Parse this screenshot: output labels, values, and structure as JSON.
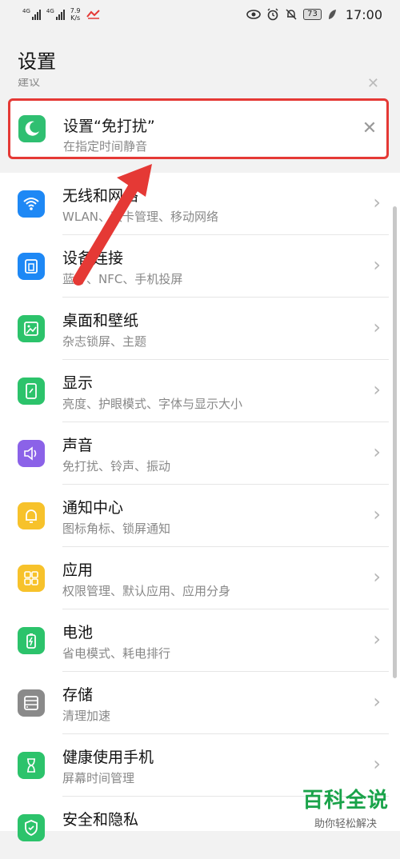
{
  "status_bar": {
    "signal1": "4G",
    "signal2": "4G",
    "speed_value": "7.9",
    "speed_unit": "K/s",
    "battery": "73",
    "time": "17:00"
  },
  "page": {
    "title": "设置",
    "faded_header": "建议"
  },
  "suggestion": {
    "title": "设置“免打扰”",
    "subtitle": "在指定时间静音",
    "icon": "moon-icon",
    "color": "#2fbf71"
  },
  "settings": [
    {
      "title": "无线和网络",
      "subtitle": "WLAN、双卡管理、移动网络",
      "icon": "wifi-icon",
      "color": "#1e88f5"
    },
    {
      "title": "设备连接",
      "subtitle": "蓝牙、NFC、手机投屏",
      "icon": "device-connect-icon",
      "color": "#1e88f5"
    },
    {
      "title": "桌面和壁纸",
      "subtitle": "杂志锁屏、主题",
      "icon": "wallpaper-icon",
      "color": "#2cc36b"
    },
    {
      "title": "显示",
      "subtitle": "亮度、护眼模式、字体与显示大小",
      "icon": "display-icon",
      "color": "#2cc36b"
    },
    {
      "title": "声音",
      "subtitle": "免打扰、铃声、振动",
      "icon": "speaker-icon",
      "color": "#8b62e8"
    },
    {
      "title": "通知中心",
      "subtitle": "图标角标、锁屏通知",
      "icon": "bell-icon",
      "color": "#f7c22b"
    },
    {
      "title": "应用",
      "subtitle": "权限管理、默认应用、应用分身",
      "icon": "apps-grid-icon",
      "color": "#f7c22b"
    },
    {
      "title": "电池",
      "subtitle": "省电模式、耗电排行",
      "icon": "battery-icon",
      "color": "#2cc36b"
    },
    {
      "title": "存储",
      "subtitle": "清理加速",
      "icon": "storage-icon",
      "color": "#8a8a8a"
    },
    {
      "title": "健康使用手机",
      "subtitle": "屏幕时间管理",
      "icon": "hourglass-icon",
      "color": "#2cc36b"
    },
    {
      "title": "安全和隐私",
      "subtitle": "",
      "icon": "shield-icon",
      "color": "#2cc36b"
    }
  ],
  "watermark": {
    "main": "百科全说",
    "sub": "助你轻松解决"
  },
  "accent": {
    "highlight": "#e53935"
  }
}
